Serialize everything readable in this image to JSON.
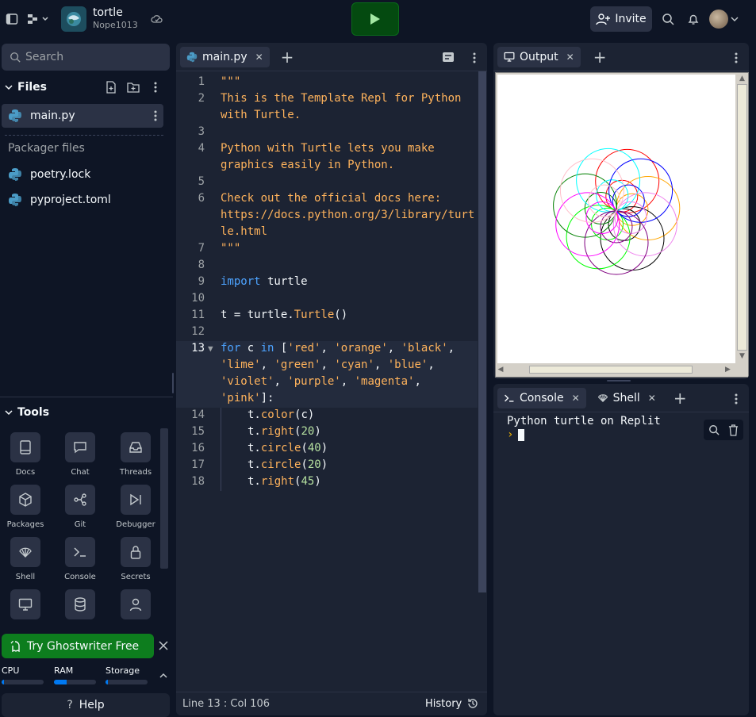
{
  "topbar": {
    "repl_name": "tortle",
    "owner": "Nope1013",
    "invite_label": "Invite"
  },
  "sidebar": {
    "search_placeholder": "Search",
    "files_heading": "Files",
    "files": [
      "main.py"
    ],
    "packager_heading": "Packager files",
    "packager_files": [
      "poetry.lock",
      "pyproject.toml"
    ],
    "tools_heading": "Tools",
    "tools": [
      "Docs",
      "Chat",
      "Threads",
      "Packages",
      "Git",
      "Debugger",
      "Shell",
      "Console",
      "Secrets"
    ],
    "ghostwriter_label": "Try Ghostwriter Free",
    "resources": [
      "CPU",
      "RAM",
      "Storage"
    ],
    "ram_fraction": 0.3,
    "cpu_fraction": 0.05,
    "storage_fraction": 0.05,
    "help_label": "Help"
  },
  "editor": {
    "tab_label": "main.py",
    "status_position": "Line 13 : Col 106",
    "history_label": "History"
  },
  "output": {
    "tab_label": "Output"
  },
  "console": {
    "tab_console": "Console",
    "tab_shell": "Shell",
    "output_text": "Python turtle on Replit",
    "prompt": "›"
  }
}
